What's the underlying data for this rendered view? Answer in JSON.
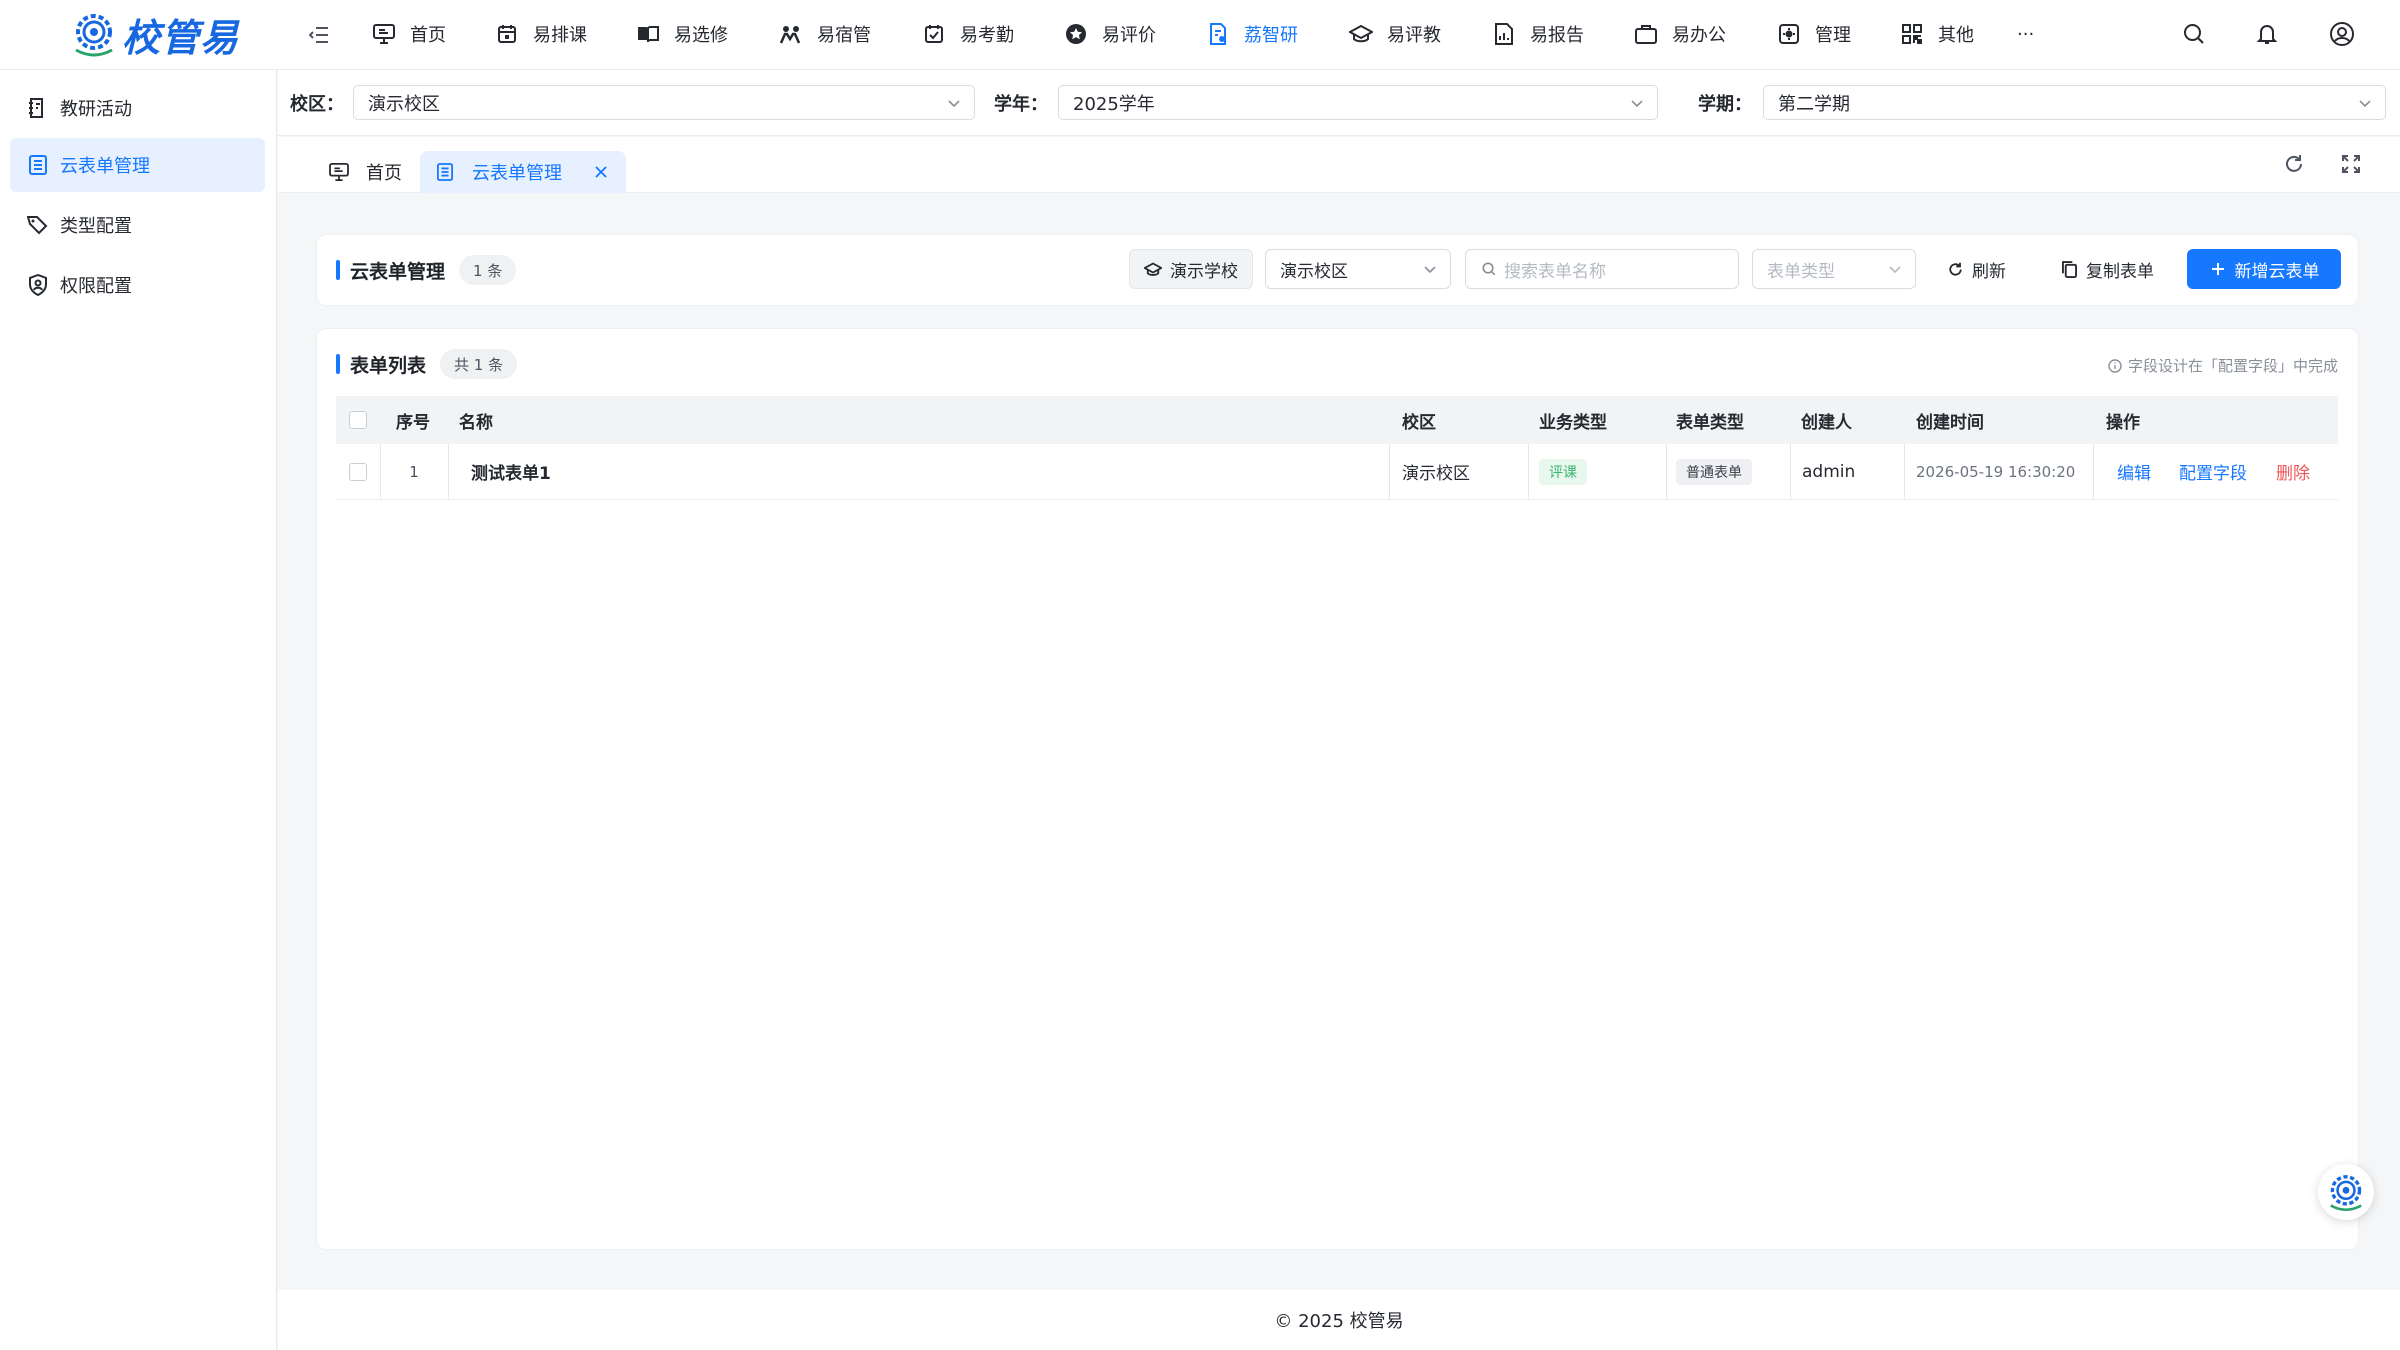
{
  "brand": {
    "name": "校管易",
    "color": "#1768e0",
    "icon": "school-gear-logo"
  },
  "nav": {
    "items": [
      {
        "label": "首页",
        "icon": "monitor-icon"
      },
      {
        "label": "易排课",
        "icon": "calendar-icon"
      },
      {
        "label": "易选修",
        "icon": "book-open-icon"
      },
      {
        "label": "易宿管",
        "icon": "dorm-people-icon"
      },
      {
        "label": "易考勤",
        "icon": "calendar-check-icon"
      },
      {
        "label": "易评价",
        "icon": "star-circle-icon"
      },
      {
        "label": "荔智研",
        "icon": "research-doc-icon",
        "active": true
      },
      {
        "label": "易评教",
        "icon": "graduation-cap-icon"
      },
      {
        "label": "易报告",
        "icon": "report-chart-icon"
      },
      {
        "label": "易办公",
        "icon": "briefcase-icon"
      },
      {
        "label": "管理",
        "icon": "settings-square-icon"
      },
      {
        "label": "其他",
        "icon": "grid-apps-icon"
      }
    ],
    "more": "···",
    "accent": "#1677ff"
  },
  "sidebar": {
    "items": [
      {
        "label": "教研活动",
        "icon": "activity-doc-icon"
      },
      {
        "label": "云表单管理",
        "icon": "form-list-icon",
        "active": true
      },
      {
        "label": "类型配置",
        "icon": "tag-icon"
      },
      {
        "label": "权限配置",
        "icon": "shield-user-icon"
      }
    ]
  },
  "filters": {
    "campus_label": "校区：",
    "campus_value": "演示校区",
    "year_label": "学年：",
    "year_value": "2025学年",
    "term_label": "学期：",
    "term_value": "第二学期"
  },
  "tabs": {
    "home": "首页",
    "current": "云表单管理"
  },
  "manage_card": {
    "title": "云表单管理",
    "count": "1 条",
    "school_btn": "演示学校",
    "campus_select": "演示校区",
    "search_placeholder": "搜索表单名称",
    "type_placeholder": "表单类型",
    "refresh_btn": "刷新",
    "copy_btn": "复制表单",
    "add_btn": "新增云表单"
  },
  "list_card": {
    "title": "表单列表",
    "count": "共 1 条",
    "hint": "字段设计在「配置字段」中完成",
    "columns": [
      "序号",
      "名称",
      "校区",
      "业务类型",
      "表单类型",
      "创建人",
      "创建时间",
      "操作"
    ],
    "rows": [
      {
        "index": "1",
        "name": "测试表单1",
        "campus": "演示校区",
        "biz_type": "评课",
        "form_type": "普通表单",
        "creator": "admin",
        "created_at": "2026-05-19 16:30:20",
        "actions": {
          "edit": "编辑",
          "config": "配置字段",
          "delete": "删除"
        }
      }
    ]
  },
  "footer": {
    "text": "© 2025 校管易"
  }
}
